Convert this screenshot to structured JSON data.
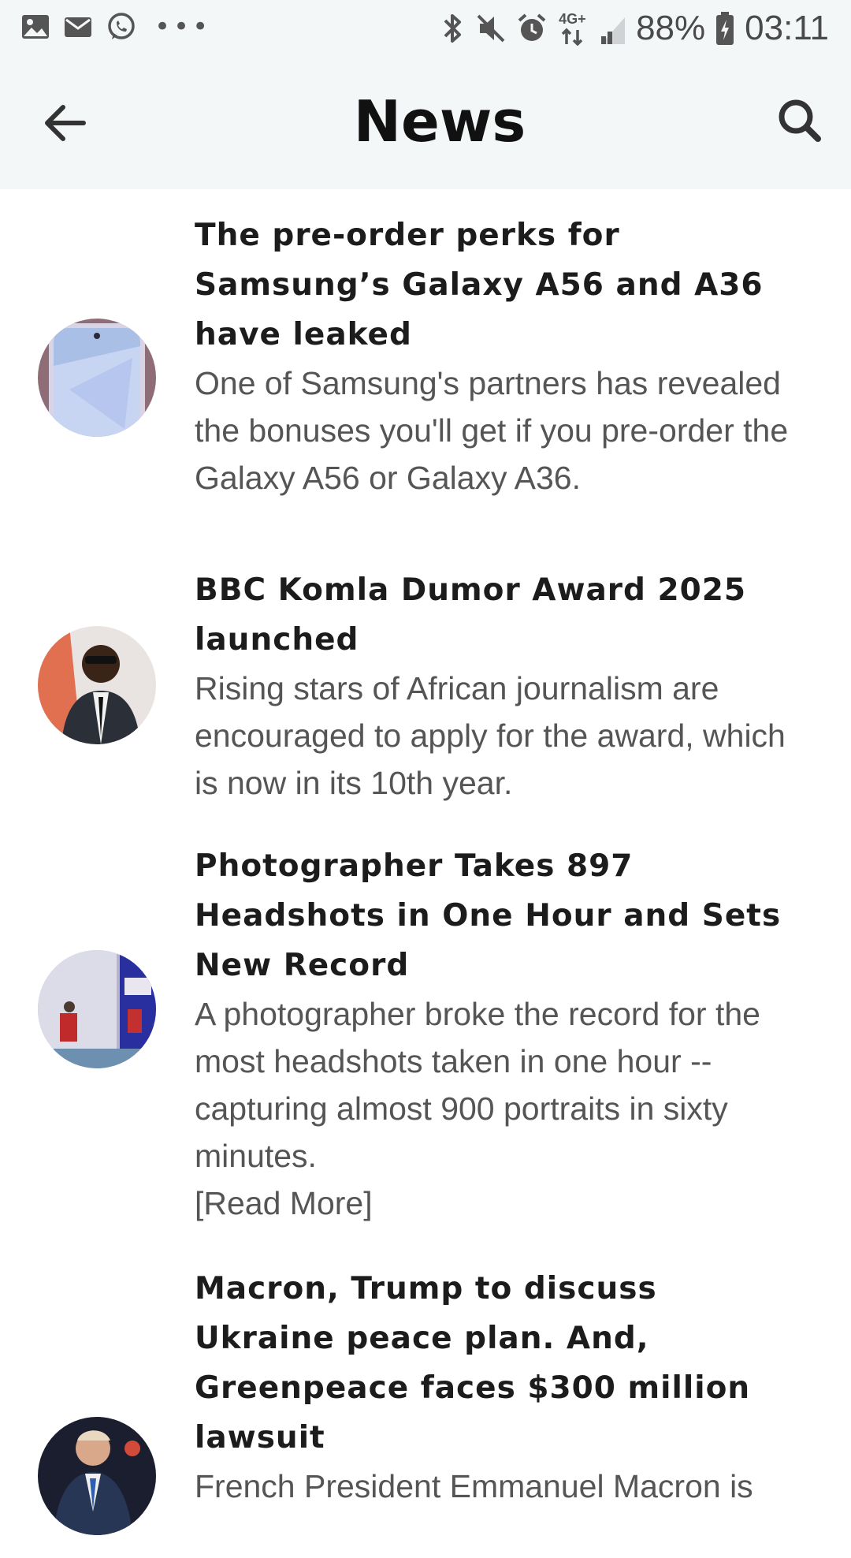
{
  "status_bar": {
    "notifications": [
      "gallery-icon",
      "mail-icon",
      "whatsapp-icon",
      "more-dots-icon"
    ],
    "more_label": "•••",
    "system_icons": [
      "bluetooth-icon",
      "mute-icon",
      "alarm-icon",
      "network-4g-icon",
      "signal-icon"
    ],
    "network_label": "4G+",
    "battery_percent": "88%",
    "time": "03:11"
  },
  "header": {
    "title": "News",
    "back_icon": "arrow-left-icon",
    "search_icon": "search-icon"
  },
  "articles": [
    {
      "headline": "The pre-order perks for Samsung’s Galaxy A56 and A36 have leaked",
      "summary": "One of Samsung's partners has revealed the bonuses you'll get if you pre-order the Galaxy A56 or Galaxy A36.",
      "thumbnail": "phone-thumbnail"
    },
    {
      "headline": "BBC Komla Dumor Award 2025 launched",
      "summary": "Rising stars of African journalism are encouraged to apply for the award, which is now in its 10th year.",
      "thumbnail": "presenter-thumbnail"
    },
    {
      "headline": "Photographer Takes 897 Headshots in One Hour and Sets New Record",
      "summary": "A photographer broke the record for the most headshots taken in one hour -- capturing almost 900 portraits in sixty minutes.",
      "read_more": "[Read More]",
      "thumbnail": "studio-thumbnail"
    },
    {
      "headline": "Macron, Trump to discuss Ukraine peace plan. And, Greenpeace faces $300 million lawsuit",
      "summary": "French President Emmanuel Macron is",
      "thumbnail": "politician-thumbnail"
    }
  ],
  "colors": {
    "bar_background": "#f4f7f8",
    "headline_text": "#1c1c1c",
    "summary_text": "#555555"
  }
}
